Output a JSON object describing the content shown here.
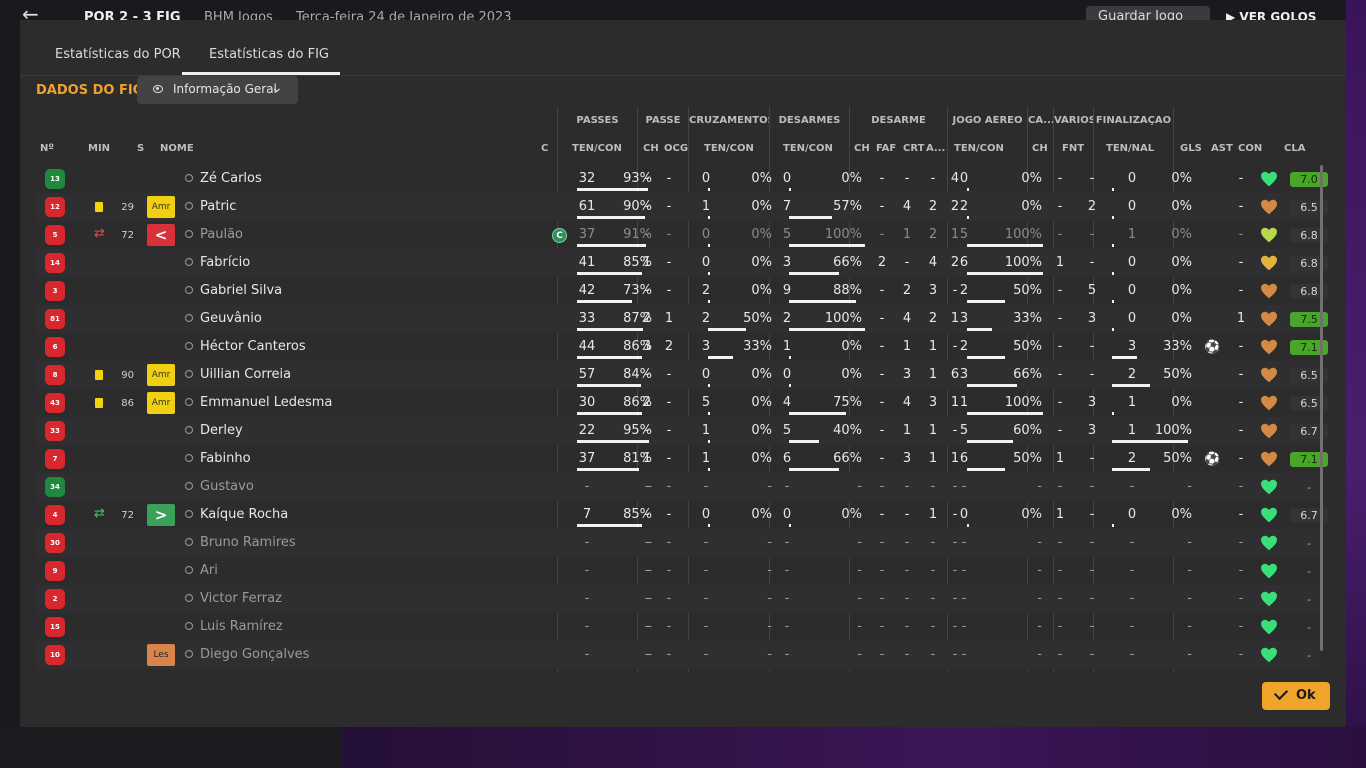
{
  "topbar": {
    "score": "POR  2 - 3  FIG",
    "competition": "BHM Jogos",
    "date": "Terça-feira 24 de Janeiro de 2023",
    "save_label": "Guardar Jogo",
    "goals_label": "VER GOLOS"
  },
  "tabs": [
    {
      "label": "Estatísticas do POR",
      "active": false
    },
    {
      "label": "Estatísticas do FIG",
      "active": true
    }
  ],
  "section_title": "DADOS DO FIG",
  "view_dropdown": {
    "selected": "Informação Geral"
  },
  "groups": [
    "PASSES",
    "PASSE",
    "CRUZAMENTOS",
    "DESARMES",
    "DESARME",
    "JOGO AÉREO",
    "CA...",
    "VÁRIOS",
    "FINALIZAÇÃO"
  ],
  "columns": [
    "Nº",
    "MIN",
    "S",
    "NOME",
    "C",
    "TEN/CON",
    "CH",
    "OCG",
    "TEN/CON",
    "TEN/CON",
    "CH",
    "FAF",
    "CRT",
    "A...",
    "TEN/CON",
    "CH",
    "FNT",
    "TEN/NAL",
    "GLS",
    "AST",
    "CON",
    "CLA"
  ],
  "players": [
    {
      "num": "13",
      "kit": "green",
      "card": false,
      "sub": "",
      "min": "",
      "badge": "",
      "badge_text": "",
      "name": "Zé Carlos",
      "captain": false,
      "pas": "32",
      "pas_pct": "93%",
      "pch": "-",
      "ocg": "-",
      "cru": "0",
      "cru_pct": "0%",
      "des": "0",
      "des_pct": "0%",
      "dch": "-",
      "faf": "-",
      "crt": "-",
      "a": "4",
      "air": "0",
      "air_pct": "0%",
      "ca": "-",
      "fnt": "-",
      "fin": "0",
      "fin_pct": "0%",
      "gls": "",
      "ast": "-",
      "con": "green",
      "cla": "7.0",
      "cla_good": true
    },
    {
      "num": "12",
      "kit": "red",
      "card": true,
      "sub": "",
      "min": "29",
      "badge": "amr",
      "badge_text": "Amr",
      "name": "Patric",
      "captain": false,
      "pas": "61",
      "pas_pct": "90%",
      "pch": "-",
      "ocg": "-",
      "cru": "1",
      "cru_pct": "0%",
      "des": "7",
      "des_pct": "57%",
      "dch": "-",
      "faf": "4",
      "crt": "2",
      "a": "2",
      "air": "2",
      "air_pct": "0%",
      "ca": "-",
      "fnt": "2",
      "fin": "0",
      "fin_pct": "0%",
      "gls": "",
      "ast": "-",
      "con": "orange",
      "cla": "6.5",
      "cla_good": false
    },
    {
      "num": "5",
      "kit": "red",
      "card": false,
      "sub": "out",
      "min": "72",
      "badge": "out",
      "badge_text": "<",
      "name": "Paulão",
      "captain": true,
      "pas": "37",
      "pas_pct": "91%",
      "pch": "-",
      "ocg": "-",
      "cru": "0",
      "cru_pct": "0%",
      "des": "5",
      "des_pct": "100%",
      "dch": "-",
      "faf": "1",
      "crt": "2",
      "a": "1",
      "air": "5",
      "air_pct": "100%",
      "ca": "-",
      "fnt": "-",
      "fin": "1",
      "fin_pct": "0%",
      "gls": "",
      "ast": "-",
      "con": "yellowgreen",
      "cla": "6.8",
      "cla_good": false
    },
    {
      "num": "14",
      "kit": "red",
      "card": false,
      "sub": "",
      "min": "",
      "badge": "",
      "badge_text": "",
      "name": "Fabrício",
      "captain": false,
      "pas": "41",
      "pas_pct": "85%",
      "pch": "1",
      "ocg": "-",
      "cru": "0",
      "cru_pct": "0%",
      "des": "3",
      "des_pct": "66%",
      "dch": "2",
      "faf": "-",
      "crt": "4",
      "a": "2",
      "air": "6",
      "air_pct": "100%",
      "ca": "1",
      "fnt": "-",
      "fin": "0",
      "fin_pct": "0%",
      "gls": "",
      "ast": "-",
      "con": "gold",
      "cla": "6.8",
      "cla_good": false
    },
    {
      "num": "3",
      "kit": "red",
      "card": false,
      "sub": "",
      "min": "",
      "badge": "",
      "badge_text": "",
      "name": "Gabriel Silva",
      "captain": false,
      "pas": "42",
      "pas_pct": "73%",
      "pch": "-",
      "ocg": "-",
      "cru": "2",
      "cru_pct": "0%",
      "des": "9",
      "des_pct": "88%",
      "dch": "-",
      "faf": "2",
      "crt": "3",
      "a": "-",
      "air": "2",
      "air_pct": "50%",
      "ca": "-",
      "fnt": "5",
      "fin": "0",
      "fin_pct": "0%",
      "gls": "",
      "ast": "-",
      "con": "orange",
      "cla": "6.8",
      "cla_good": false
    },
    {
      "num": "81",
      "kit": "red",
      "card": false,
      "sub": "",
      "min": "",
      "badge": "",
      "badge_text": "",
      "name": "Geuvânio",
      "captain": false,
      "pas": "33",
      "pas_pct": "87%",
      "pch": "2",
      "ocg": "1",
      "cru": "2",
      "cru_pct": "50%",
      "des": "2",
      "des_pct": "100%",
      "dch": "-",
      "faf": "4",
      "crt": "2",
      "a": "1",
      "air": "3",
      "air_pct": "33%",
      "ca": "-",
      "fnt": "3",
      "fin": "0",
      "fin_pct": "0%",
      "gls": "",
      "ast": "1",
      "con": "orange",
      "cla": "7.5",
      "cla_good": true
    },
    {
      "num": "6",
      "kit": "red",
      "card": false,
      "sub": "",
      "min": "",
      "badge": "",
      "badge_text": "",
      "name": "Héctor Canteros",
      "captain": false,
      "pas": "44",
      "pas_pct": "86%",
      "pch": "3",
      "ocg": "2",
      "cru": "3",
      "cru_pct": "33%",
      "des": "1",
      "des_pct": "0%",
      "dch": "-",
      "faf": "1",
      "crt": "1",
      "a": "-",
      "air": "2",
      "air_pct": "50%",
      "ca": "-",
      "fnt": "-",
      "fin": "3",
      "fin_pct": "33%",
      "gls": "ball",
      "ast": "-",
      "con": "orange",
      "cla": "7.1",
      "cla_good": true
    },
    {
      "num": "8",
      "kit": "red",
      "card": true,
      "sub": "",
      "min": "90",
      "badge": "amr",
      "badge_text": "Amr",
      "name": "Uillian Correia",
      "captain": false,
      "pas": "57",
      "pas_pct": "84%",
      "pch": "-",
      "ocg": "-",
      "cru": "0",
      "cru_pct": "0%",
      "des": "0",
      "des_pct": "0%",
      "dch": "-",
      "faf": "3",
      "crt": "1",
      "a": "6",
      "air": "3",
      "air_pct": "66%",
      "ca": "-",
      "fnt": "-",
      "fin": "2",
      "fin_pct": "50%",
      "gls": "",
      "ast": "-",
      "con": "orange",
      "cla": "6.5",
      "cla_good": false
    },
    {
      "num": "43",
      "kit": "red",
      "card": true,
      "sub": "",
      "min": "86",
      "badge": "amr",
      "badge_text": "Amr",
      "name": "Emmanuel Ledesma",
      "captain": false,
      "pas": "30",
      "pas_pct": "86%",
      "pch": "2",
      "ocg": "-",
      "cru": "5",
      "cru_pct": "0%",
      "des": "4",
      "des_pct": "75%",
      "dch": "-",
      "faf": "4",
      "crt": "3",
      "a": "1",
      "air": "1",
      "air_pct": "100%",
      "ca": "-",
      "fnt": "3",
      "fin": "1",
      "fin_pct": "0%",
      "gls": "",
      "ast": "-",
      "con": "orange",
      "cla": "6.5",
      "cla_good": false
    },
    {
      "num": "33",
      "kit": "red",
      "card": false,
      "sub": "",
      "min": "",
      "badge": "",
      "badge_text": "",
      "name": "Derley",
      "captain": false,
      "pas": "22",
      "pas_pct": "95%",
      "pch": "-",
      "ocg": "-",
      "cru": "1",
      "cru_pct": "0%",
      "des": "5",
      "des_pct": "40%",
      "dch": "-",
      "faf": "1",
      "crt": "1",
      "a": "-",
      "air": "5",
      "air_pct": "60%",
      "ca": "-",
      "fnt": "3",
      "fin": "1",
      "fin_pct": "100%",
      "gls": "",
      "ast": "-",
      "con": "orange",
      "cla": "6.7",
      "cla_good": false
    },
    {
      "num": "7",
      "kit": "red",
      "card": false,
      "sub": "",
      "min": "",
      "badge": "",
      "badge_text": "",
      "name": "Fabinho",
      "captain": false,
      "pas": "37",
      "pas_pct": "81%",
      "pch": "1",
      "ocg": "-",
      "cru": "1",
      "cru_pct": "0%",
      "des": "6",
      "des_pct": "66%",
      "dch": "-",
      "faf": "3",
      "crt": "1",
      "a": "1",
      "air": "6",
      "air_pct": "50%",
      "ca": "1",
      "fnt": "-",
      "fin": "2",
      "fin_pct": "50%",
      "gls": "ball",
      "ast": "-",
      "con": "orange",
      "cla": "7.1",
      "cla_good": true
    },
    {
      "num": "34",
      "kit": "green",
      "card": false,
      "sub": "",
      "min": "",
      "badge": "",
      "badge_text": "",
      "name": "Gustavo",
      "captain": false,
      "bench": true,
      "pas": "-",
      "pas_pct": "-",
      "pch": "-",
      "ocg": "-",
      "cru": "-",
      "cru_pct": "-",
      "des": "-",
      "des_pct": "-",
      "dch": "-",
      "faf": "-",
      "crt": "-",
      "a": "-",
      "air": "-",
      "air_pct": "-",
      "ca": "-",
      "fnt": "-",
      "fin": "-",
      "fin_pct": "-",
      "gls": "",
      "ast": "-",
      "con": "green",
      "cla": "-",
      "cla_good": false
    },
    {
      "num": "4",
      "kit": "red",
      "card": false,
      "sub": "in",
      "min": "72",
      "badge": "in",
      "badge_text": ">",
      "name": "Kaíque Rocha",
      "captain": false,
      "pas": "7",
      "pas_pct": "85%",
      "pch": "-",
      "ocg": "-",
      "cru": "0",
      "cru_pct": "0%",
      "des": "0",
      "des_pct": "0%",
      "dch": "-",
      "faf": "-",
      "crt": "1",
      "a": "-",
      "air": "0",
      "air_pct": "0%",
      "ca": "1",
      "fnt": "-",
      "fin": "0",
      "fin_pct": "0%",
      "gls": "",
      "ast": "-",
      "con": "green",
      "cla": "6.7",
      "cla_good": false
    },
    {
      "num": "30",
      "kit": "red",
      "card": false,
      "sub": "",
      "min": "",
      "badge": "",
      "badge_text": "",
      "name": "Bruno Ramires",
      "captain": false,
      "bench": true,
      "pas": "-",
      "pas_pct": "-",
      "pch": "-",
      "ocg": "-",
      "cru": "-",
      "cru_pct": "-",
      "des": "-",
      "des_pct": "-",
      "dch": "-",
      "faf": "-",
      "crt": "-",
      "a": "-",
      "air": "-",
      "air_pct": "-",
      "ca": "-",
      "fnt": "-",
      "fin": "-",
      "fin_pct": "-",
      "gls": "",
      "ast": "-",
      "con": "green",
      "cla": "-",
      "cla_good": false
    },
    {
      "num": "9",
      "kit": "red",
      "card": false,
      "sub": "",
      "min": "",
      "badge": "",
      "badge_text": "",
      "name": "Ari",
      "captain": false,
      "bench": true,
      "pas": "-",
      "pas_pct": "-",
      "pch": "-",
      "ocg": "-",
      "cru": "-",
      "cru_pct": "-",
      "des": "-",
      "des_pct": "-",
      "dch": "-",
      "faf": "-",
      "crt": "-",
      "a": "-",
      "air": "-",
      "air_pct": "-",
      "ca": "-",
      "fnt": "-",
      "fin": "-",
      "fin_pct": "-",
      "gls": "",
      "ast": "-",
      "con": "green",
      "cla": "-",
      "cla_good": false
    },
    {
      "num": "2",
      "kit": "red",
      "card": false,
      "sub": "",
      "min": "",
      "badge": "",
      "badge_text": "",
      "name": "Victor Ferraz",
      "captain": false,
      "bench": true,
      "pas": "-",
      "pas_pct": "-",
      "pch": "-",
      "ocg": "-",
      "cru": "-",
      "cru_pct": "-",
      "des": "-",
      "des_pct": "-",
      "dch": "-",
      "faf": "-",
      "crt": "-",
      "a": "-",
      "air": "-",
      "air_pct": "-",
      "ca": "-",
      "fnt": "-",
      "fin": "-",
      "fin_pct": "-",
      "gls": "",
      "ast": "-",
      "con": "green",
      "cla": "-",
      "cla_good": false
    },
    {
      "num": "15",
      "kit": "red",
      "card": false,
      "sub": "",
      "min": "",
      "badge": "",
      "badge_text": "",
      "name": "Luis Ramírez",
      "captain": false,
      "bench": true,
      "pas": "-",
      "pas_pct": "-",
      "pch": "-",
      "ocg": "-",
      "cru": "-",
      "cru_pct": "-",
      "des": "-",
      "des_pct": "-",
      "dch": "-",
      "faf": "-",
      "crt": "-",
      "a": "-",
      "air": "-",
      "air_pct": "-",
      "ca": "-",
      "fnt": "-",
      "fin": "-",
      "fin_pct": "-",
      "gls": "",
      "ast": "-",
      "con": "green",
      "cla": "-",
      "cla_good": false
    },
    {
      "num": "10",
      "kit": "red",
      "card": false,
      "sub": "",
      "min": "",
      "badge": "les",
      "badge_text": "Les",
      "name": "Diego Gonçalves",
      "captain": false,
      "bench": true,
      "pas": "-",
      "pas_pct": "-",
      "pch": "-",
      "ocg": "-",
      "cru": "-",
      "cru_pct": "-",
      "des": "-",
      "des_pct": "-",
      "dch": "-",
      "faf": "-",
      "crt": "-",
      "a": "-",
      "air": "-",
      "air_pct": "-",
      "ca": "-",
      "fnt": "-",
      "fin": "-",
      "fin_pct": "-",
      "gls": "",
      "ast": "-",
      "con": "green",
      "cla": "-",
      "cla_good": false
    }
  ],
  "captain_label": "C",
  "ok_label": "Ok",
  "colors": {
    "accent": "#f0a030",
    "ok": "#f0a52a",
    "rating_good": "#4aa52a",
    "kit_red": "#d8282e",
    "kit_green": "#1f8a3e"
  }
}
